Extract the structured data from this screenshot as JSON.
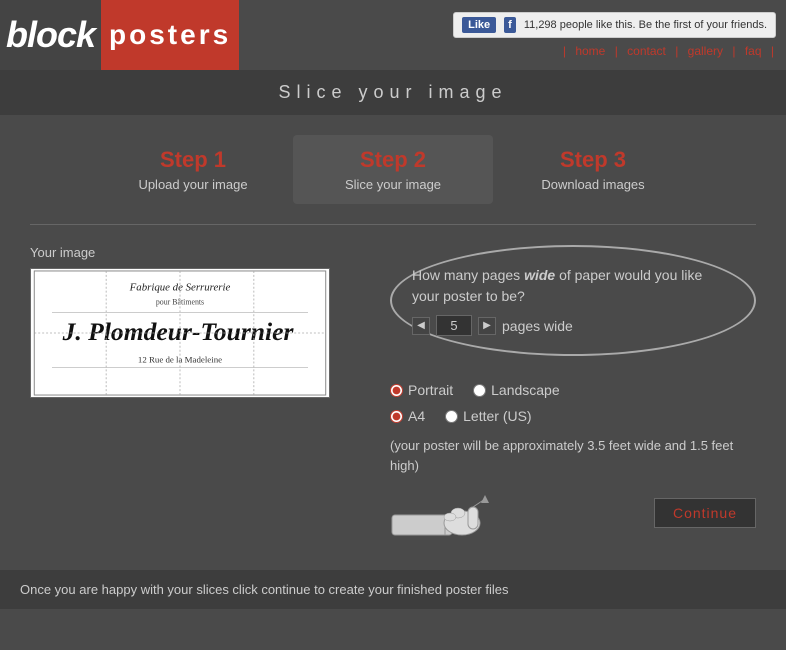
{
  "header": {
    "logo_block": "block",
    "logo_posters": "posters",
    "fb_like": "Like",
    "fb_count": "11,298 people like this. Be the first of your friends.",
    "nav": {
      "home": "home",
      "contact": "contact",
      "gallery": "gallery",
      "faq": "faq"
    }
  },
  "page_title": "Slice your image",
  "steps": [
    {
      "number": "Step 1",
      "label": "Upload your image",
      "active": false
    },
    {
      "number": "Step 2",
      "label": "Slice your image",
      "active": true
    },
    {
      "number": "Step 3",
      "label": "Download images",
      "active": false
    }
  ],
  "left_panel": {
    "label": "Your image"
  },
  "right_panel": {
    "pages_wide_question": "How many pages ",
    "pages_wide_italic": "wide",
    "pages_wide_question2": " of paper would you like your poster to be?",
    "pages_value": "5",
    "pages_unit": "pages wide",
    "portrait_label": "Portrait",
    "landscape_label": "Landscape",
    "a4_label": "A4",
    "letter_label": "Letter (US)",
    "size_text": "(your poster will be approximately 3.5 feet wide and 1.5 feet high)",
    "continue_label": "Continue"
  },
  "bottom_bar": {
    "text": "Once you are happy with your slices click continue to create your finished poster files"
  }
}
